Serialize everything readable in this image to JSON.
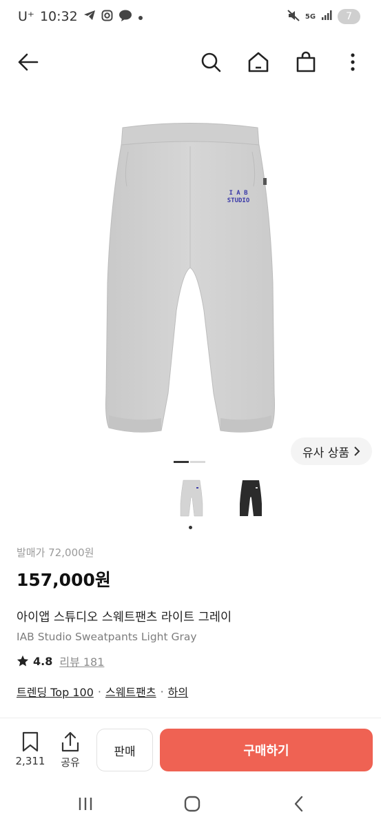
{
  "status_bar": {
    "carrier": "U⁺",
    "time": "10:32",
    "network": "5G",
    "battery": "7",
    "icons": [
      "telegram-icon",
      "instagram-icon",
      "talk-icon",
      "dot-icon",
      "mute-icon",
      "signal-icon"
    ]
  },
  "nav": {
    "icons": [
      "back-arrow-icon",
      "search-icon",
      "home-icon",
      "shopping-bag-icon",
      "more-vertical-icon"
    ]
  },
  "product_image": {
    "logo_line1": "I A B",
    "logo_line2": "STUDIO"
  },
  "similar_button": {
    "label": "유사 상품",
    "icon": "chevron-right-icon"
  },
  "image_indicator": {
    "count": 2,
    "active": 1
  },
  "thumbnails": [
    {
      "color": "#d4d4d4",
      "selected": true
    },
    {
      "color": "#2b2b2b",
      "selected": false
    }
  ],
  "info": {
    "release_price": "발매가 72,000원",
    "price": "157,000원",
    "name_ko": "아이앱 스튜디오 스웨트팬츠 라이트 그레이",
    "name_en": "IAB Studio Sweatpants Light Gray",
    "rating": "4.8",
    "review_label": "리뷰 181",
    "tags": [
      "트렌딩 Top 100",
      "스웨트팬츠",
      "하의"
    ],
    "tag_separator": "·"
  },
  "bottom_bar": {
    "bookmark_count": "2,311",
    "share_label": "공유",
    "sell_label": "판매",
    "buy_label": "구매하기",
    "buy_color": "#ef6253"
  },
  "system_nav": {
    "icons": [
      "recent-apps-icon",
      "home-circle-icon",
      "back-chevron-icon"
    ]
  }
}
